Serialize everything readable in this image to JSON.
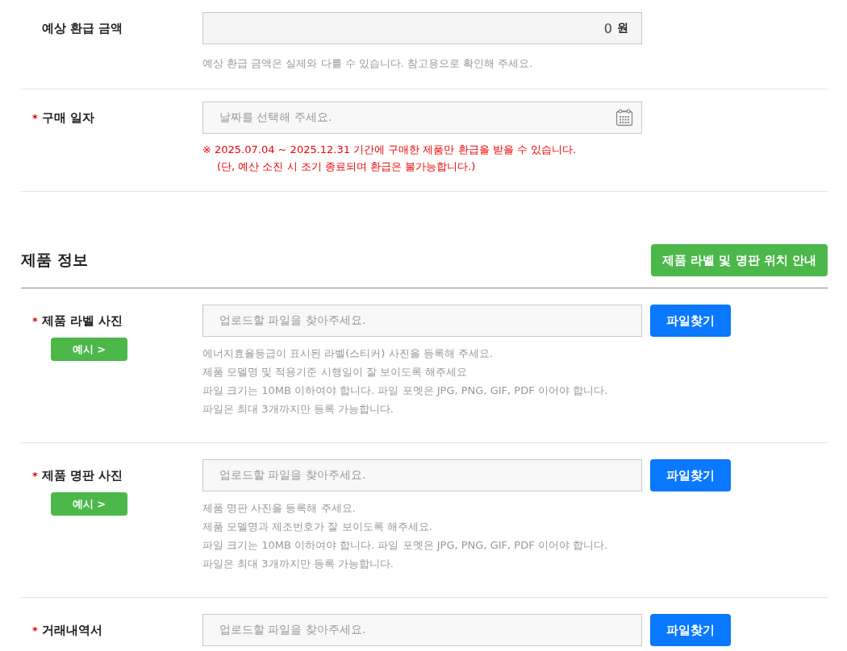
{
  "rows": [
    {
      "kind": "amount",
      "label": "예상 환급 금액",
      "value": "0",
      "unit": "원",
      "help": [
        "예상 환급 금액은 실제와 다를 수 있습니다. 참고용으로 확인해 주세요."
      ]
    },
    {
      "kind": "date",
      "label": "구매 일자",
      "required_mark": "*",
      "placeholder": "날짜를 선택해 주세요.",
      "notes": [
        "※ 2025.07.04 ~ 2025.12.31 기간에 구매한 제품만 환급을 받을 수 있습니다.",
        "(단, 예산 소진 시 조기 종료되며 환급은 불가능합니다.)"
      ]
    }
  ],
  "section": {
    "title": "제품 정보",
    "guide_button": "제품 라벨 및 명판 위치 안내"
  },
  "uploads": [
    {
      "label": "제품 라벨 사진",
      "required_mark": "*",
      "example_button": "예시 >",
      "placeholder": "업로드할 파일을 찾아주세요.",
      "button": "파일찾기",
      "help": [
        "에너지효율등급이 표시된 라벨(스티커) 사진을 등록해 주세요.",
        "제품 모델명 및 적용기준 시행일이 잘 보이도록 해주세요",
        "파일 크기는 10MB 이하여야 합니다. 파일 포멧은 JPG, PNG, GIF, PDF 이어야 합니다.",
        "파일은 최대 3개까지만 등록 가능합니다."
      ]
    },
    {
      "label": "제품 명판 사진",
      "required_mark": "*",
      "example_button": "예시 >",
      "placeholder": "업로드할 파일을 찾아주세요.",
      "button": "파일찾기",
      "help": [
        "제품 명판 사진을 등록해 주세요.",
        "제품 모델명과 제조번호가 잘 보이도록 해주세요.",
        "파일 크기는 10MB 이하여야 합니다. 파일 포멧은 JPG, PNG, GIF, PDF 이어야 합니다.",
        "파일은 최대 3개까지만 등록 가능합니다."
      ]
    },
    {
      "label": "거래내역서",
      "required_mark": "*",
      "placeholder": "업로드할 파일을 찾아주세요.",
      "button": "파일찾기"
    }
  ]
}
